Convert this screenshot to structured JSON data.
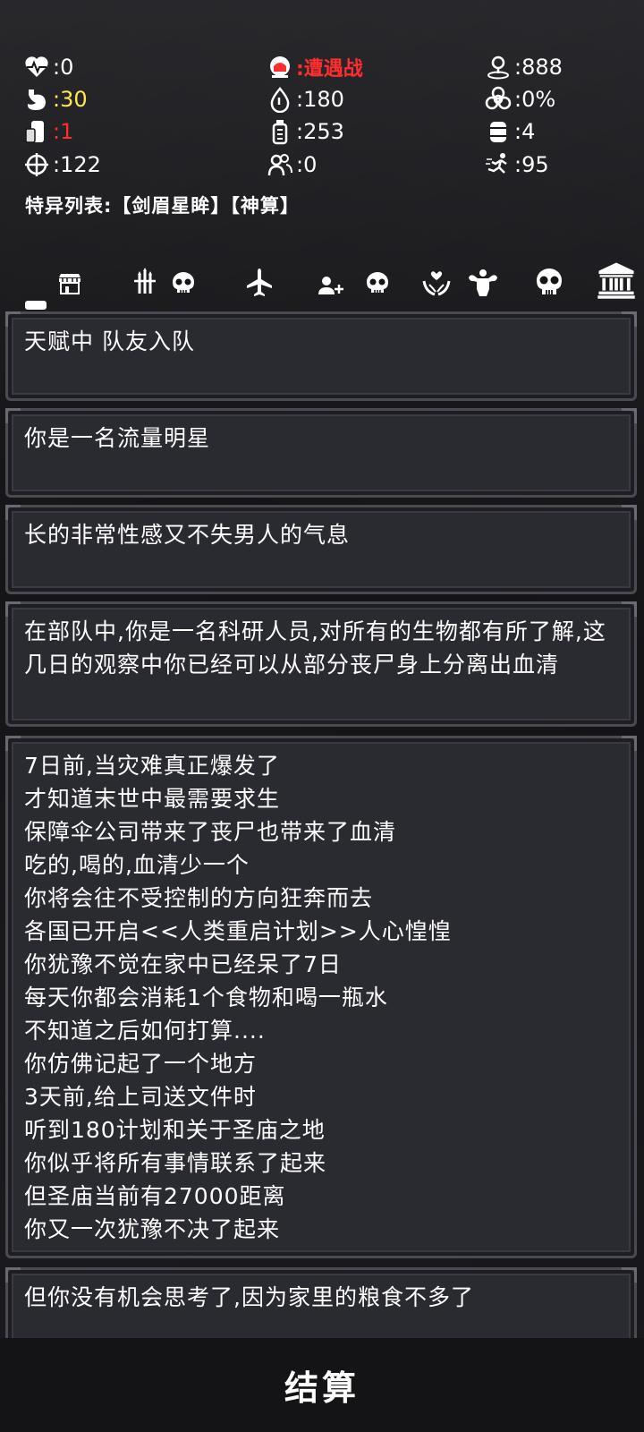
{
  "colors": {
    "normal": "#ffffff",
    "yellow": "#ffe94a",
    "red": "#ff2d2d"
  },
  "stats": {
    "health": ":0",
    "encounter": ":遭遇战",
    "distance": ":888",
    "hunger": ":30",
    "water": ":180",
    "infection": ":0%",
    "food": ":1",
    "bottles": ":253",
    "supplies": ":4",
    "aim": ":122",
    "teammates": ":0",
    "agility": ":95"
  },
  "traits": "特异列表:【剑眉星眸】【神算】",
  "tabs": [
    "shop",
    "weapons",
    "skull",
    "plane",
    "add-friend",
    "skull",
    "charity",
    "strength",
    "skull",
    "bank"
  ],
  "cards": [
    "天赋中 队友入队",
    "你是一名流量明星",
    "长的非常性感又不失男人的气息",
    "在部队中,你是一名科研人员,对所有的生物都有所了解,这几日的观察中你已经可以从部分丧尸身上分离出血清",
    "7日前,当灾难真正爆发了\n才知道末世中最需要求生\n保障伞公司带来了丧尸也带来了血清\n吃的,喝的,血清少一个\n你将会往不受控制的方向狂奔而去\n各国已开启<<人类重启计划>>人心惶惶\n你犹豫不觉在家中已经呆了7日\n每天你都会消耗1个食物和喝一瓶水\n不知道之后如何打算....\n你仿佛记起了一个地方\n3天前,给上司送文件时\n听到180计划和关于圣庙之地\n你似乎将所有事情联系了起来\n但圣庙当前有27000距离\n你又一次犹豫不决了起来",
    "但你没有机会思考了,因为家里的粮食不多了"
  ],
  "settle_label": "结算"
}
